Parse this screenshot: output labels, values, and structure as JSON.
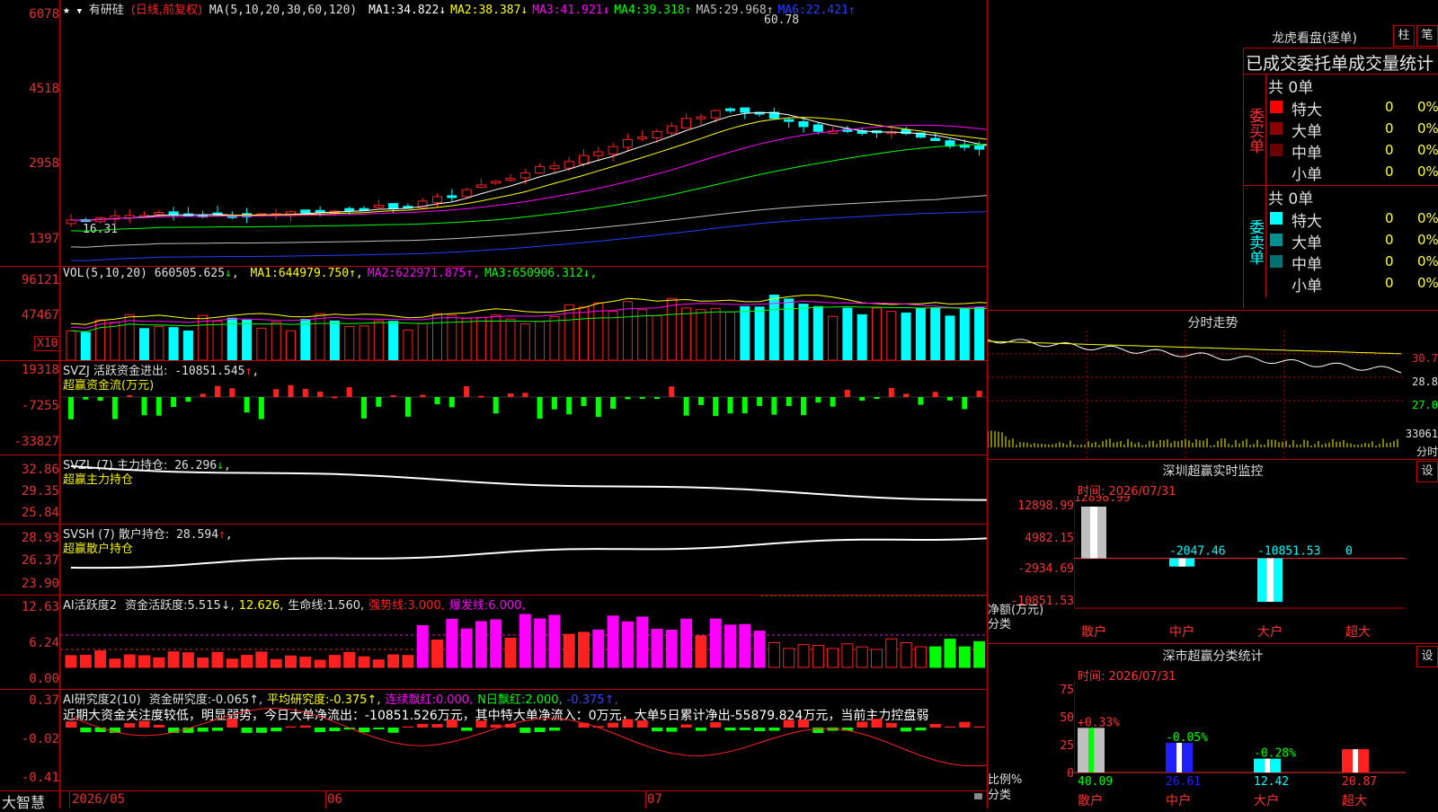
{
  "stock": {
    "name": "有研硅",
    "mode": "(日线,前复权)",
    "ma_params": "MA(5,10,20,30,60,120)",
    "ma_values": [
      {
        "label": "MA1:",
        "value": "34.822",
        "arrow": "↓",
        "color": "#ffffff"
      },
      {
        "label": "MA2:",
        "value": "38.387",
        "arrow": "↓",
        "color": "#ffff00"
      },
      {
        "label": "MA3:",
        "value": "41.921",
        "arrow": "↓",
        "color": "#ff00ff"
      },
      {
        "label": "MA4:",
        "value": "39.318",
        "arrow": "↑",
        "color": "#00ff00"
      },
      {
        "label": "MA5:",
        "value": "29.968",
        "arrow": "↑",
        "color": "#c0c0c0"
      },
      {
        "label": "MA6:",
        "value": "22.421",
        "arrow": "↑",
        "color": "#2040ff"
      }
    ],
    "high_label": "60.78",
    "low_label": "16.31",
    "y_labels": [
      "6078",
      "4518",
      "2958",
      "1397"
    ]
  },
  "vol": {
    "header": "VOL(5,10,20)",
    "value": "660505.625",
    "value_arrow": "↓",
    "mas": [
      {
        "label": "MA1:",
        "value": "644979.750",
        "arrow": "↑",
        "color": "#ffff00"
      },
      {
        "label": "MA2:",
        "value": "622971.875",
        "arrow": "↑",
        "color": "#ff00ff"
      },
      {
        "label": "MA3:",
        "value": "650906.312",
        "arrow": "↓",
        "color": "#00ff00"
      }
    ],
    "y_labels": [
      "96121",
      "47467"
    ],
    "unit": "X10"
  },
  "svzj": {
    "header": "SVZJ  活跃资金进出:",
    "value": "-10851.545",
    "arrow": "↑",
    "subtitle": "超赢资金流(万元)",
    "y_labels": [
      "19318",
      "-7255",
      "-33827"
    ]
  },
  "svzl": {
    "header": "SVZL (7) 主力持仓:",
    "value": "26.296",
    "arrow": "↓",
    "subtitle": "超赢主力持仓",
    "y_labels": [
      "32.86",
      "29.35",
      "25.84"
    ]
  },
  "svsh": {
    "header": "SVSH (7) 散户持仓:",
    "value": "28.594",
    "arrow": "↑",
    "subtitle": "超赢散户持仓",
    "y_labels": [
      "28.93",
      "26.37",
      "23.90"
    ]
  },
  "ai1": {
    "header": "AI活跃度2",
    "items": [
      {
        "label": "资金活跃度:",
        "value": "5.515",
        "arrow": "↓",
        "color": "#e0e0e0"
      },
      {
        "label": "",
        "value": "12.626",
        "arrow": "",
        "color": "#ffff00"
      },
      {
        "label": "生命线:",
        "value": "1.560",
        "arrow": "",
        "color": "#e0e0e0"
      },
      {
        "label": "强势线:",
        "value": "3.000",
        "arrow": "",
        "color": "#ff2020"
      },
      {
        "label": "爆发线:",
        "value": "6.000",
        "arrow": "",
        "color": "#ff00ff"
      }
    ],
    "y_labels": [
      "12.63",
      "6.24",
      "0.00"
    ]
  },
  "ai2": {
    "header": "AI研究度2(10)",
    "items": [
      {
        "label": "资金研究度:",
        "value": "-0.065",
        "arrow": "↑",
        "color": "#e0e0e0"
      },
      {
        "label": "平均研究度:",
        "value": "-0.375",
        "arrow": "↑",
        "color": "#ffff00"
      },
      {
        "label": "连续飘红:",
        "value": "0.000",
        "arrow": "",
        "color": "#ff00ff"
      },
      {
        "label": "N日飘红:",
        "value": "2.000",
        "arrow": "",
        "color": "#00ff00"
      },
      {
        "label": "",
        "value": "-0.375",
        "arrow": "↑",
        "color": "#4040ff"
      }
    ],
    "commentary": "近期大资金关注度较低，明显弱势，今日大单净流出：-10851.526万元，其中特大单净流入：0万元，大单5日累计净出-55879.824万元，当前主力控盘弱",
    "y_labels": [
      "0.37",
      "-0.02",
      "-0.41"
    ]
  },
  "footer": {
    "brand": "大智慧",
    "dates": [
      "2026/05",
      "06",
      "07"
    ]
  },
  "right": {
    "dragon_title": "龙虎看盘(逐单)",
    "btn_col": "柱",
    "btn_bi": "笔",
    "stats_title": "已成交委托单成交量统计",
    "buy_label": "委买单",
    "sell_label": "委卖单",
    "buy_total": "共 0单",
    "sell_total": "共 0单",
    "buy_rows": [
      {
        "name": "特大",
        "count": "0",
        "pct": "0%",
        "color": "#ff0000"
      },
      {
        "name": "大单",
        "count": "0",
        "pct": "0%",
        "color": "#8b0000"
      },
      {
        "name": "中单",
        "count": "0",
        "pct": "0%",
        "color": "#6a0000"
      },
      {
        "name": "小单",
        "count": "0",
        "pct": "0%",
        "color": ""
      }
    ],
    "sell_rows": [
      {
        "name": "特大",
        "count": "0",
        "pct": "0%",
        "color": "#00ffff"
      },
      {
        "name": "大单",
        "count": "0",
        "pct": "0%",
        "color": "#009090"
      },
      {
        "name": "中单",
        "count": "0",
        "pct": "0%",
        "color": "#007070"
      },
      {
        "name": "小单",
        "count": "0",
        "pct": "0%",
        "color": ""
      }
    ],
    "intraday_title": "分时走势",
    "intraday_labels": [
      "30.7",
      "28.8",
      "27.0"
    ],
    "intraday_vol": "33061",
    "intraday_unit": "分时",
    "sz_title": "深圳超赢实时监控",
    "sz_btn": "设",
    "sz_time": "时间: 2026/07/31",
    "sz_y": [
      "12898.99",
      "4982.15",
      "-2934.69",
      "-10851.53"
    ],
    "sz_values": [
      {
        "cat": "散户",
        "value": 12898.99,
        "text": "12898.99"
      },
      {
        "cat": "中户",
        "value": -2047.46,
        "text": "-2047.46"
      },
      {
        "cat": "大户",
        "value": -10851.53,
        "text": "-10851.53"
      },
      {
        "cat": "超大",
        "value": 0,
        "text": "0"
      }
    ],
    "sz_ylabel": "净额(万元)",
    "sz_xlabel": "分类",
    "cls_title": "深市超赢分类统计",
    "cls_btn": "设",
    "cls_time": "时间: 2026/07/31",
    "cls_y": [
      "75",
      "50",
      "25",
      "0"
    ],
    "cls_values": [
      {
        "cat": "散户",
        "value": 40.09,
        "pct": "+0.33%",
        "pct_color": "#ff3030"
      },
      {
        "cat": "中户",
        "value": 26.61,
        "pct": "-0.05%",
        "pct_color": "#00ff00"
      },
      {
        "cat": "大户",
        "value": 12.42,
        "pct": "-0.28%",
        "pct_color": "#00ff00"
      },
      {
        "cat": "超大",
        "value": 20.87,
        "pct": "",
        "pct_color": "#ff3030"
      }
    ],
    "cls_ylabel": "比例%",
    "cls_xlabel": "分类"
  },
  "chart_data": {
    "type": "bar",
    "categories": [
      "散户",
      "中户",
      "大户",
      "超大"
    ],
    "series": [
      {
        "name": "净额(万元)",
        "values": [
          12898.99,
          -2047.46,
          -10851.53,
          0
        ]
      },
      {
        "name": "比例%",
        "values": [
          40.09,
          26.61,
          12.42,
          20.87
        ]
      }
    ],
    "ylabel": "净额(万元)",
    "xlabel": "分类"
  }
}
